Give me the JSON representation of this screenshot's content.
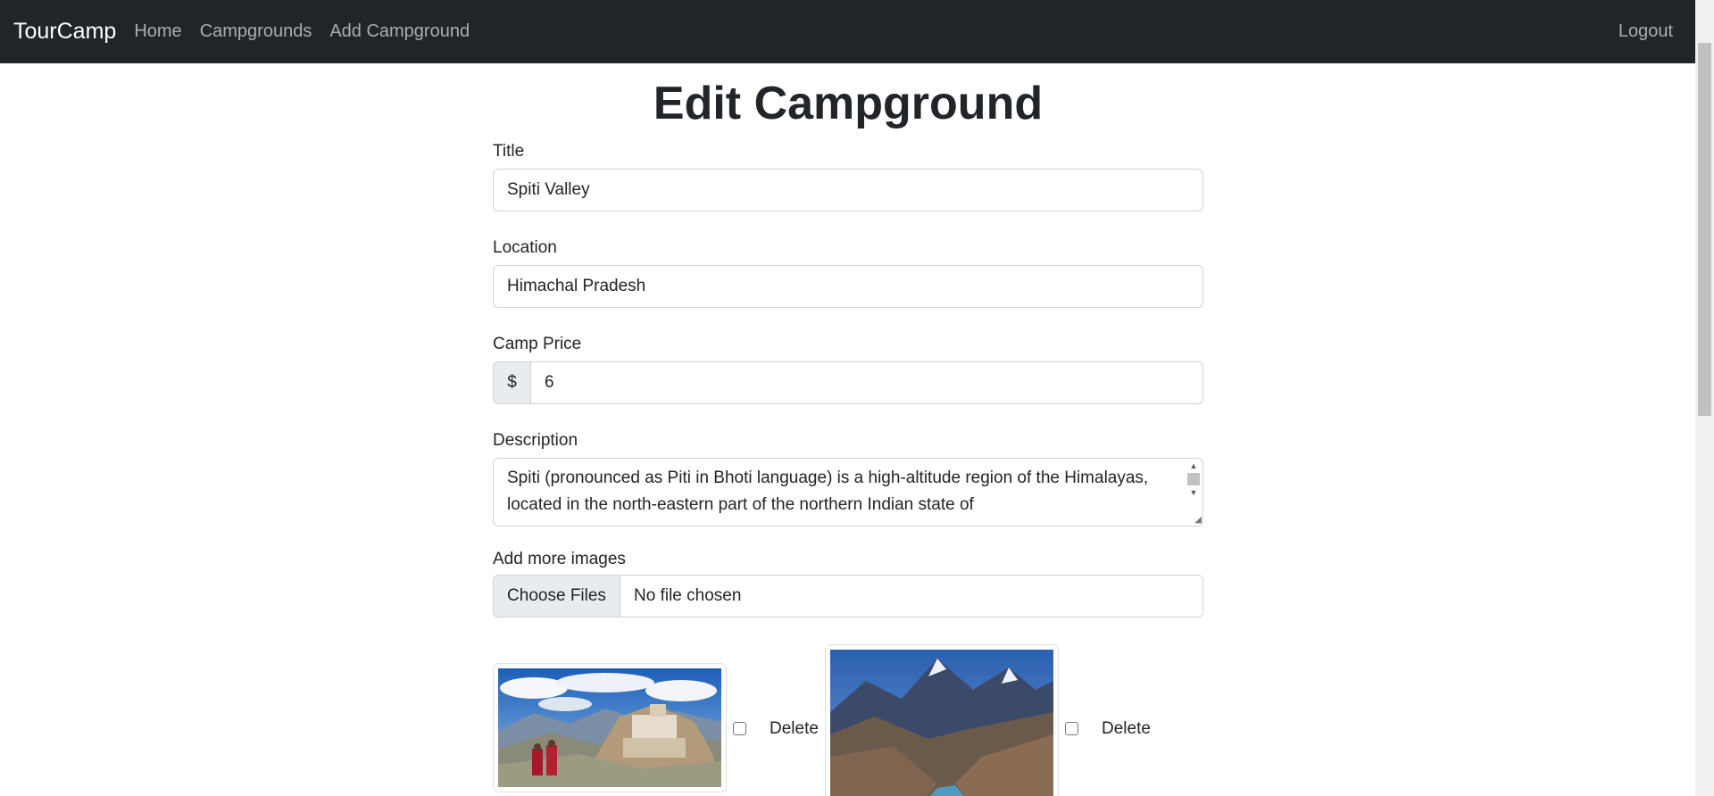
{
  "navbar": {
    "brand": "TourCamp",
    "links": [
      "Home",
      "Campgrounds",
      "Add Campground"
    ],
    "logout": "Logout"
  },
  "page": {
    "title": "Edit Campground"
  },
  "form": {
    "title": {
      "label": "Title",
      "value": "Spiti Valley"
    },
    "location": {
      "label": "Location",
      "value": "Himachal Pradesh"
    },
    "price": {
      "label": "Camp Price",
      "currency": "$",
      "value": "6"
    },
    "description": {
      "label": "Description",
      "value": "Spiti (pronounced as Piti in Bhoti language) is a high-altitude region of the Himalayas, located in the north-eastern part of the northern Indian state of"
    },
    "images": {
      "label": "Add more images",
      "button": "Choose Files",
      "status": "No file chosen"
    }
  },
  "existing_images": [
    {
      "alt": "Monastery on a hillside with two monks",
      "delete_label": "Delete"
    },
    {
      "alt": "Mountain valley with a river",
      "delete_label": "Delete"
    }
  ]
}
